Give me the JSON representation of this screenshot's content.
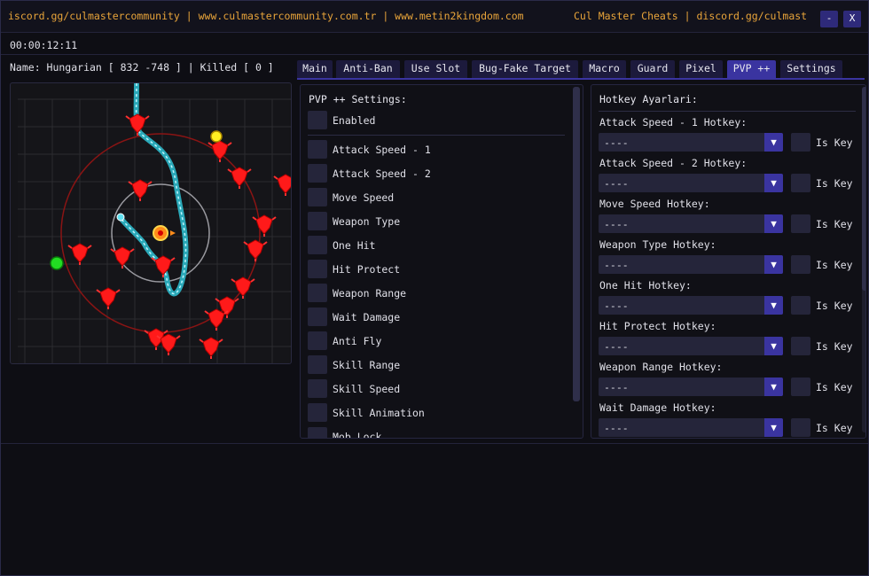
{
  "window": {
    "title_left": "iscord.gg/culmastercommunity | www.culmastercommunity.com.tr | www.metin2kingdom.com",
    "title_right": "Cul Master Cheats | discord.gg/culmast",
    "minimize_label": "-",
    "close_label": "X"
  },
  "status": {
    "timer": "00:00:12:11",
    "info": "Name: Hungarian [ 832 -748 ] | Killed [ 0 ]"
  },
  "tabs": [
    {
      "label": "Main"
    },
    {
      "label": "Anti-Ban"
    },
    {
      "label": "Use Slot"
    },
    {
      "label": "Bug-Fake Target"
    },
    {
      "label": "Macro"
    },
    {
      "label": "Guard"
    },
    {
      "label": "Pixel"
    },
    {
      "label": "PVP ++",
      "active": true
    },
    {
      "label": "Settings"
    }
  ],
  "pvp": {
    "title": "PVP ++ Settings:",
    "enabled_label": "Enabled",
    "options": [
      {
        "label": "Attack Speed - 1"
      },
      {
        "label": "Attack Speed - 2"
      },
      {
        "label": "Move Speed"
      },
      {
        "label": "Weapon Type"
      },
      {
        "label": "One Hit"
      },
      {
        "label": "Hit Protect"
      },
      {
        "label": "Weapon Range"
      },
      {
        "label": "Wait Damage"
      },
      {
        "label": "Anti Fly"
      },
      {
        "label": "Skill Range"
      },
      {
        "label": "Skill Speed"
      },
      {
        "label": "Skill Animation"
      },
      {
        "label": "Mob Lock"
      }
    ]
  },
  "hotkeys": {
    "title": "Hotkey Ayarlari:",
    "is_key_label": "Is Key",
    "items": [
      {
        "label": "Attack Speed - 1 Hotkey:",
        "value": "----"
      },
      {
        "label": "Attack Speed - 2 Hotkey:",
        "value": "----"
      },
      {
        "label": "Move Speed Hotkey:",
        "value": "----"
      },
      {
        "label": "Weapon Type Hotkey:",
        "value": "----"
      },
      {
        "label": "One Hit Hotkey:",
        "value": "----"
      },
      {
        "label": "Hit Protect Hotkey:",
        "value": "----"
      },
      {
        "label": "Weapon Range Hotkey:",
        "value": "----"
      },
      {
        "label": "Wait Damage Hotkey:",
        "value": "----"
      }
    ]
  },
  "colors": {
    "accent": "#3a34a0",
    "title_text": "#e8a43a",
    "enemy": "#ff1a1a",
    "path": "#5fe0f0",
    "player": "#ff8c1a",
    "ally": "#22dd22",
    "target": "#ffee22"
  },
  "icons": {
    "dropdown": "▼",
    "player_marker": "player-marker-icon",
    "enemy_marker": "enemy-marker-icon"
  }
}
